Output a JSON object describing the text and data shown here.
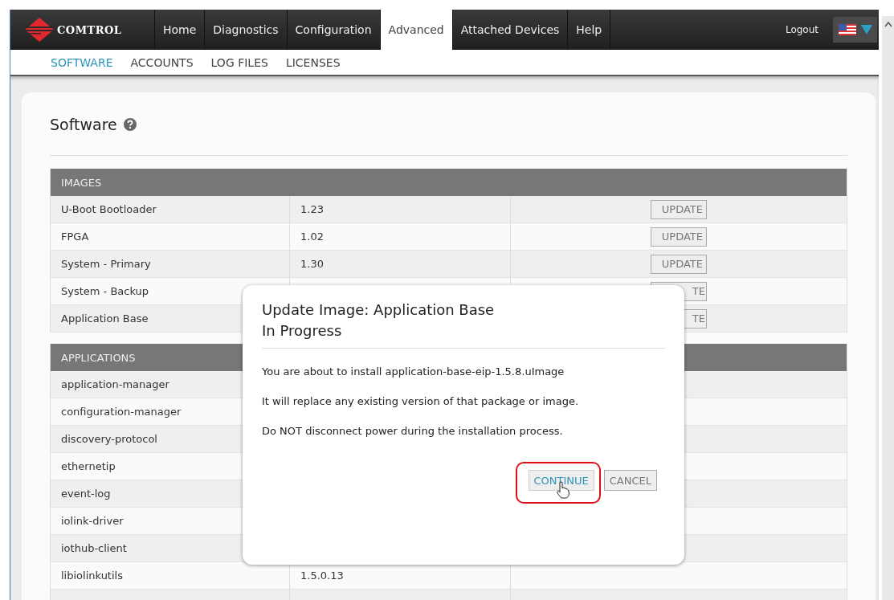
{
  "nav": {
    "logo": "COMTROL",
    "tabs": [
      {
        "label": "Home",
        "selected": false
      },
      {
        "label": "Diagnostics",
        "selected": false
      },
      {
        "label": "Configuration",
        "selected": false
      },
      {
        "label": "Advanced",
        "selected": true
      },
      {
        "label": "Attached Devices",
        "selected": false
      },
      {
        "label": "Help",
        "selected": false
      }
    ],
    "logout": "Logout"
  },
  "subnav": [
    {
      "label": "SOFTWARE",
      "selected": true
    },
    {
      "label": "ACCOUNTS",
      "selected": false
    },
    {
      "label": "LOG FILES",
      "selected": false
    },
    {
      "label": "LICENSES",
      "selected": false
    }
  ],
  "page_title": "Software",
  "images": {
    "heading": "IMAGES",
    "rows": [
      {
        "name": "U-Boot Bootloader",
        "version": "1.23",
        "action": "UPDATE"
      },
      {
        "name": "FPGA",
        "version": "1.02",
        "action": "UPDATE"
      },
      {
        "name": "System - Primary",
        "version": "1.30",
        "action": "UPDATE"
      },
      {
        "name": "System - Backup",
        "action": "TE"
      },
      {
        "name": "Application Base",
        "action": "TE"
      }
    ]
  },
  "applications": {
    "heading": "APPLICATIONS",
    "rows": [
      {
        "name": "application-manager"
      },
      {
        "name": "configuration-manager"
      },
      {
        "name": "discovery-protocol"
      },
      {
        "name": "ethernetip"
      },
      {
        "name": "event-log"
      },
      {
        "name": "iolink-driver"
      },
      {
        "name": "iothub-client"
      },
      {
        "name": "libiolinkutils",
        "version": "1.5.0.13"
      }
    ]
  },
  "dialog": {
    "title": "Update Image: Application Base",
    "subtitle": "In Progress",
    "messages": [
      "You are about to install application-base-eip-1.5.8.uImage",
      "It will replace any existing version of that package or image.",
      "Do NOT disconnect power during the installation process."
    ],
    "buttons": [
      {
        "label": "CONTINUE",
        "highlighted": true
      },
      {
        "label": "CANCEL",
        "highlighted": false
      }
    ]
  }
}
